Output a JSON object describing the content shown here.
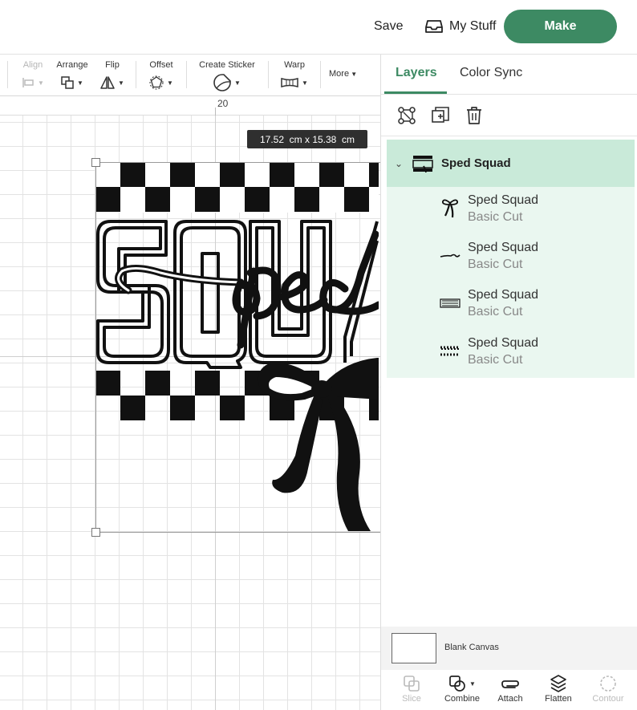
{
  "header": {
    "save_label": "Save",
    "mystuff_label": "My Stuff",
    "make_label": "Make"
  },
  "toolbar": {
    "align": "Align",
    "arrange": "Arrange",
    "flip": "Flip",
    "offset": "Offset",
    "create_sticker": "Create Sticker",
    "warp": "Warp",
    "more": "More"
  },
  "canvas": {
    "ruler_value": "20",
    "dimensions": "17.52  cm x 15.38  cm"
  },
  "panel": {
    "tabs": [
      "Layers",
      "Color Sync"
    ],
    "group": {
      "name": "Sped Squad"
    },
    "layers": [
      {
        "name": "Sped Squad",
        "type": "Basic Cut",
        "icon": "bow-icon"
      },
      {
        "name": "Sped Squad",
        "type": "Basic Cut",
        "icon": "script-icon"
      },
      {
        "name": "Sped Squad",
        "type": "Basic Cut",
        "icon": "squad-text-icon"
      },
      {
        "name": "Sped Squad",
        "type": "Basic Cut",
        "icon": "checker-icon"
      }
    ],
    "blank_canvas_label": "Blank Canvas",
    "bottom_tools": [
      "Slice",
      "Combine",
      "Attach",
      "Flatten",
      "Contour"
    ]
  },
  "colors": {
    "accent": "#3d8a63",
    "group_bg": "#c9ead9",
    "child_bg": "#eaf7f0"
  }
}
